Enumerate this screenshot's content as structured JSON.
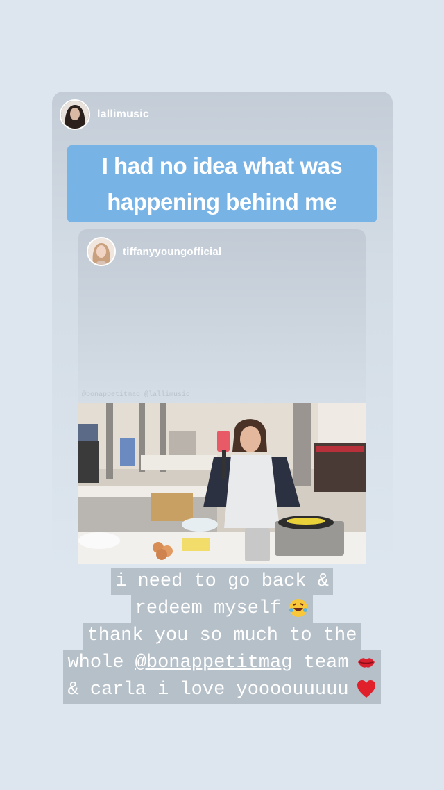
{
  "outer_post": {
    "username": "lallimusic",
    "headline_line1": "I had no idea what was",
    "headline_line2": "happening behind me"
  },
  "inner_post": {
    "username": "tiffanyyoungofficial",
    "faint_tags": "@bonappetitmag @lallimusic"
  },
  "caption": {
    "line1": "i need to go back &",
    "line2": "redeem myself",
    "line3": "thank you so much to the",
    "line4_prefix": "whole ",
    "line4_mention": "@bonappetitmag",
    "line4_suffix": " team",
    "line5": "& carla i love yoooouuuuu",
    "emoji_line2": "laughing-tears-emoji",
    "emoji_line4": "kiss-lips-emoji",
    "emoji_line5": "red-heart-emoji"
  },
  "colors": {
    "background": "#dde6ef",
    "headline_bg": "#78b3e6",
    "heart": "#e0202b"
  }
}
